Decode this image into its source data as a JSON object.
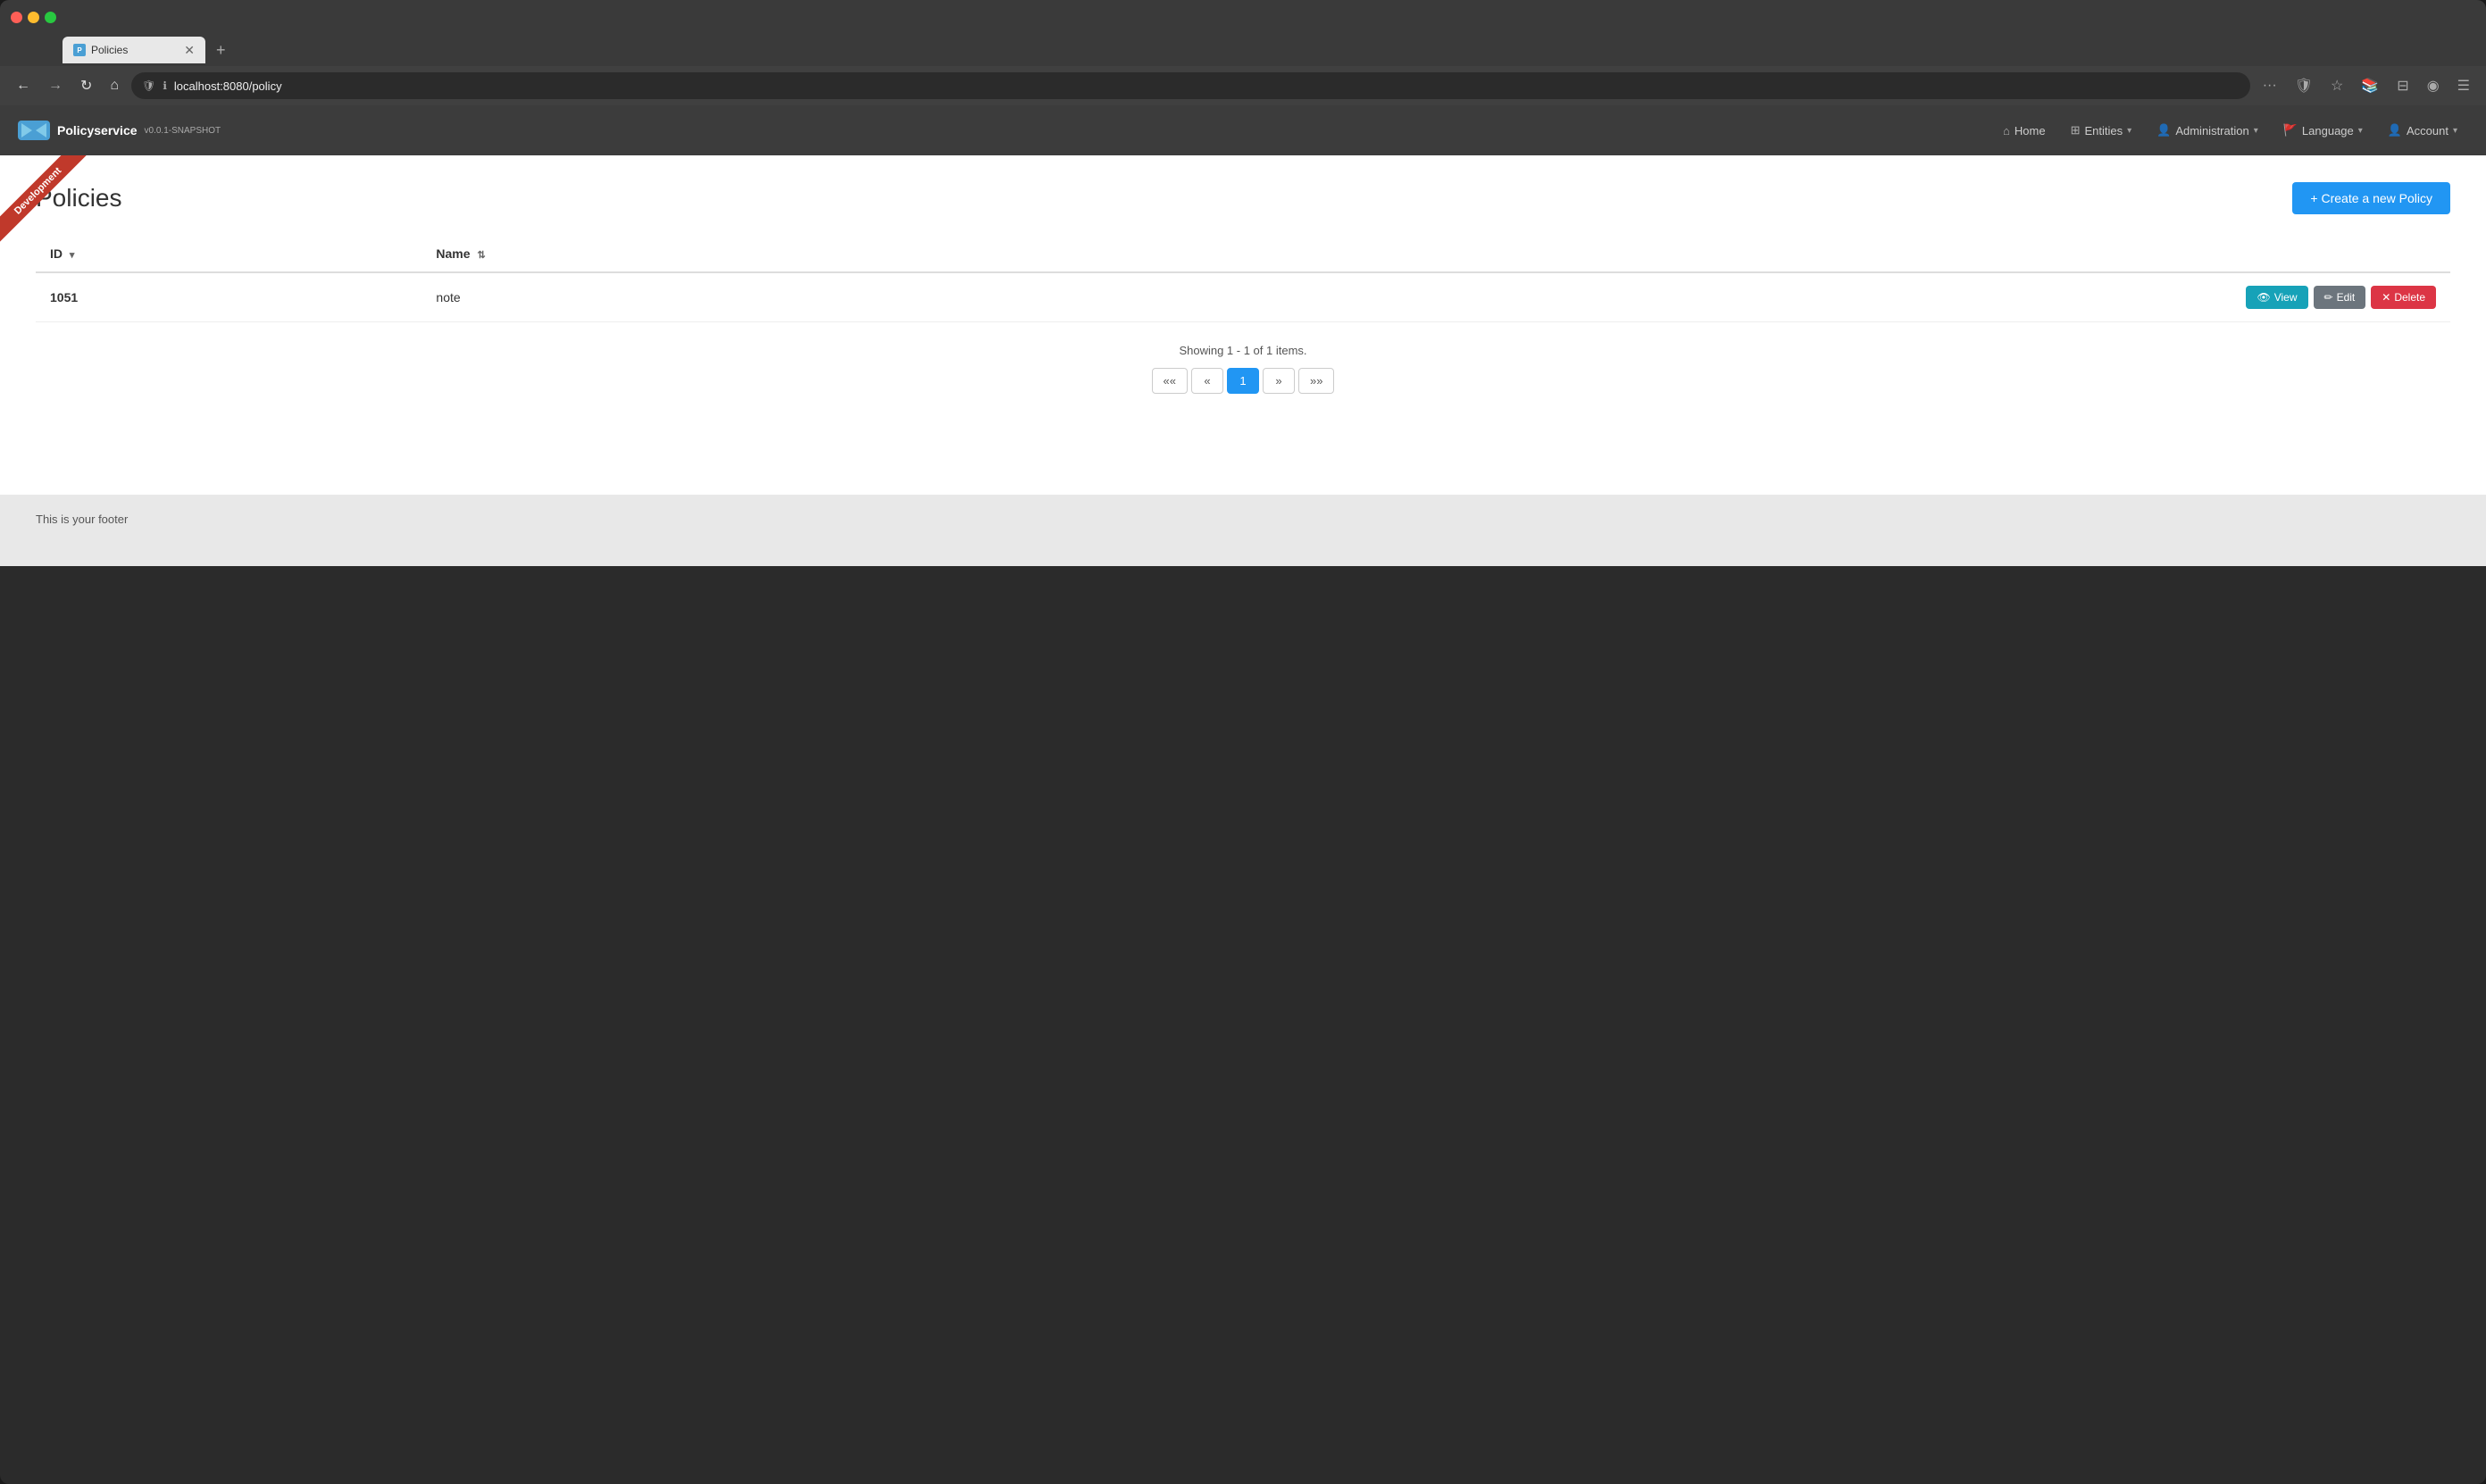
{
  "browser": {
    "tab_title": "Policies",
    "tab_favicon": "P",
    "url": "localhost:8080/policy",
    "close_btn": "✕",
    "new_tab_btn": "+",
    "nav_back": "←",
    "nav_forward": "→",
    "nav_refresh": "↻",
    "nav_home": "⌂",
    "toolbar_more": "···",
    "toolbar_shield": "🛡",
    "toolbar_star": "☆",
    "toolbar_bookmark": "📚",
    "toolbar_split": "⊟",
    "toolbar_profile": "◉",
    "toolbar_menu": "☰"
  },
  "navbar": {
    "logo_text": "Policyservice",
    "version": "v0.0.1-SNAPSHOT",
    "nav_home": "Home",
    "nav_entities": "Entities",
    "nav_administration": "Administration",
    "nav_language": "Language",
    "nav_account": "Account",
    "dev_banner": "Development"
  },
  "page": {
    "title": "Policies",
    "create_btn": "+ Create a new Policy"
  },
  "table": {
    "col_id": "ID",
    "col_name": "Name",
    "rows": [
      {
        "id": "1051",
        "name": "note"
      }
    ]
  },
  "actions": {
    "view": "View",
    "edit": "Edit",
    "delete": "Delete"
  },
  "pagination": {
    "showing_text": "Showing 1 - 1 of 1 items.",
    "first": "««",
    "prev": "«",
    "current": "1",
    "next": "»",
    "last": "»»"
  },
  "footer": {
    "text": "This is your footer"
  }
}
